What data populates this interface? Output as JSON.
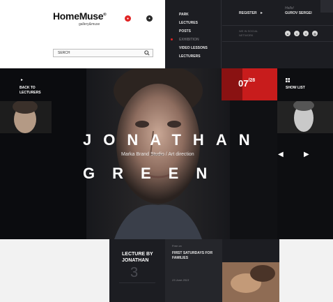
{
  "header": {
    "logo": "HomeMuse",
    "logo_sup": "®",
    "tagline": "gallery&muse",
    "search_placeholder": "SERCH"
  },
  "menu": {
    "items": [
      "PARK",
      "LECTURES",
      "POSTS",
      "EXHIBITION",
      "VIDEO LESSONS",
      "LECTURERS"
    ],
    "active": "EXHIBITION"
  },
  "account": {
    "register": "REGISTER",
    "hello": "Hello!",
    "user": "GUROV SERGEI"
  },
  "social": {
    "text": "WE IN SOCIAL NETWORK",
    "icons": [
      "vk-icon",
      "twitter-icon",
      "facebook-icon",
      "instagram-icon"
    ]
  },
  "hero": {
    "back": "BACK TO LECTURERS",
    "date_current": "07",
    "date_total": "/28",
    "show_list": "SHOW LIST",
    "first_name": "JONATHAN",
    "last_name": "GREEN",
    "subtitle": "Marka Brand Studio / Art direction"
  },
  "lecture": {
    "title": "LECTURE BY JONATHAN",
    "number": "3"
  },
  "event": {
    "small": "Free on",
    "title": "FIRST SATURDAYS FOR FAMILIES",
    "date": "23 June  2013"
  },
  "colors": {
    "accent": "#c81c1c",
    "dark": "#1c1d22"
  }
}
